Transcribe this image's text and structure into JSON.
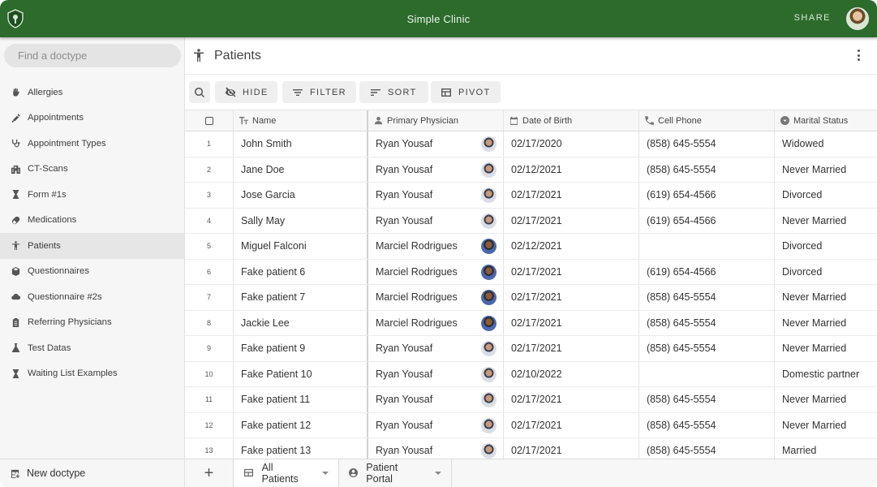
{
  "app": {
    "title": "Simple Clinic",
    "share_label": "SHARE"
  },
  "sidebar": {
    "search_placeholder": "Find a doctype",
    "items": [
      {
        "label": "Allergies",
        "icon": "hand-icon"
      },
      {
        "label": "Appointments",
        "icon": "syringe-icon"
      },
      {
        "label": "Appointment Types",
        "icon": "stethoscope-icon"
      },
      {
        "label": "CT-Scans",
        "icon": "hospital-icon"
      },
      {
        "label": "Form #1s",
        "icon": "hourglass-icon"
      },
      {
        "label": "Medications",
        "icon": "pill-icon"
      },
      {
        "label": "Patients",
        "icon": "person-icon",
        "active": true
      },
      {
        "label": "Questionnaires",
        "icon": "box-icon"
      },
      {
        "label": "Questionnaire #2s",
        "icon": "cloud-icon"
      },
      {
        "label": "Referring Physicians",
        "icon": "clipboard-icon"
      },
      {
        "label": "Test Datas",
        "icon": "flask-icon"
      },
      {
        "label": "Waiting List Examples",
        "icon": "hourglass-icon"
      }
    ],
    "new_doctype_label": "New doctype"
  },
  "page": {
    "title": "Patients"
  },
  "toolbar": {
    "hide_label": "HIDE",
    "filter_label": "FILTER",
    "sort_label": "SORT",
    "pivot_label": "PIVOT"
  },
  "table": {
    "columns": [
      "Name",
      "Primary Physician",
      "Date of Birth",
      "Cell Phone",
      "Marital Status"
    ],
    "rows": [
      {
        "n": "1",
        "name": "John Smith",
        "physician": "Ryan Yousaf",
        "avatar": "ryan",
        "dob": "02/17/2020",
        "phone": "(858) 645-5554",
        "status": "Widowed"
      },
      {
        "n": "2",
        "name": "Jane Doe",
        "physician": "Ryan Yousaf",
        "avatar": "ryan",
        "dob": "02/12/2021",
        "phone": "(858) 645-5554",
        "status": "Never Married"
      },
      {
        "n": "3",
        "name": "Jose Garcia",
        "physician": "Ryan Yousaf",
        "avatar": "ryan",
        "dob": "02/17/2021",
        "phone": "(619) 654-4566",
        "status": "Divorced"
      },
      {
        "n": "4",
        "name": "Sally May",
        "physician": "Ryan Yousaf",
        "avatar": "ryan",
        "dob": "02/17/2021",
        "phone": "(619) 654-4566",
        "status": "Never Married"
      },
      {
        "n": "5",
        "name": "Miguel Falconi",
        "physician": "Marciel Rodrigues",
        "avatar": "marciel",
        "dob": "02/12/2021",
        "phone": "",
        "status": "Divorced"
      },
      {
        "n": "6",
        "name": "Fake patient 6",
        "physician": "Marciel Rodrigues",
        "avatar": "marciel",
        "dob": "02/17/2021",
        "phone": "(619) 654-4566",
        "status": "Divorced"
      },
      {
        "n": "7",
        "name": "Fake patient 7",
        "physician": "Marciel Rodrigues",
        "avatar": "marciel",
        "dob": "02/17/2021",
        "phone": "(858) 645-5554",
        "status": "Never Married"
      },
      {
        "n": "8",
        "name": "Jackie Lee",
        "physician": "Marciel Rodrigues",
        "avatar": "marciel",
        "dob": "02/17/2021",
        "phone": "(858) 645-5554",
        "status": "Never Married"
      },
      {
        "n": "9",
        "name": "Fake patient 9",
        "physician": "Ryan Yousaf",
        "avatar": "ryan",
        "dob": "02/17/2021",
        "phone": "(858) 645-5554",
        "status": "Never Married"
      },
      {
        "n": "10",
        "name": "Fake Patient 10",
        "physician": "Ryan Yousaf",
        "avatar": "ryan",
        "dob": "02/10/2022",
        "phone": "",
        "status": "Domestic partner"
      },
      {
        "n": "11",
        "name": "Fake patient 11",
        "physician": "Ryan Yousaf",
        "avatar": "ryan",
        "dob": "02/17/2021",
        "phone": "(858) 645-5554",
        "status": "Never Married"
      },
      {
        "n": "12",
        "name": "Fake patient 12",
        "physician": "Ryan Yousaf",
        "avatar": "ryan",
        "dob": "02/17/2021",
        "phone": "(858) 645-5554",
        "status": "Never Married"
      },
      {
        "n": "13",
        "name": "Fake patient 13",
        "physician": "Ryan Yousaf",
        "avatar": "ryan",
        "dob": "02/17/2021",
        "phone": "(858) 645-5554",
        "status": "Married"
      }
    ]
  },
  "tabs": {
    "add_label": "+",
    "items": [
      {
        "label": "All Patients",
        "icon": "grid-icon",
        "active": true
      },
      {
        "label": "Patient Portal",
        "icon": "account-icon",
        "active": false
      }
    ]
  },
  "colors": {
    "brand": "#2c6b2c"
  }
}
